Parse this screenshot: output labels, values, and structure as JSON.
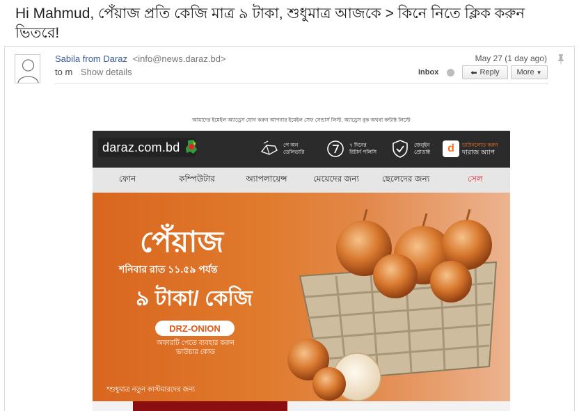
{
  "subject": "Hi Mahmud, পেঁয়াজ প্রতি কেজি মাত্র ৯ টাকা, শুধুমাত্র আজকে > কিনে নিতে ক্লিক করুন ভিতরে!",
  "header": {
    "sender_name": "Sabila from Daraz",
    "sender_email": "<info@news.daraz.bd>",
    "to_prefix": "to m",
    "show_details": "Show details",
    "date": "May 27 (1 day ago)",
    "inbox": "Inbox",
    "reply_label": "Reply",
    "more_label": "More"
  },
  "email": {
    "preheader": "আমাদের ইমেইল অ্যাড্রেস যোগ করুন আপনার ইমেইল সেফ সেন্ডার্স লিস্ট, অ্যাড্রেস বুক অথবা কন্টাক্ট লিস্টে",
    "logo_text": "daraz.com.bd",
    "features": [
      {
        "icon": "delivery-icon",
        "line1": "পে অন",
        "line2": "ডেলিভারি"
      },
      {
        "icon": "return-7-icon",
        "line1": "৭ দিনের",
        "line2": "রিটার্ন পলিসি"
      },
      {
        "icon": "genuine-shield-icon",
        "line1": "জেনুইন",
        "line2": "প্রোডাক্ট"
      }
    ],
    "app": {
      "icon_letter": "d",
      "small": "ডাউনলোড করুন",
      "big": "দারাজ অ্যাপ"
    },
    "categories": [
      "ফোন",
      "কম্পিউটার",
      "অ্যাপলায়েন্স",
      "মেয়েদের জন্য",
      "ছেলেদের জন্য",
      "সেল"
    ],
    "banner": {
      "title": "পেঁয়াজ",
      "subtitle": "শনিবার রাত ১১.৫৯ পর্যন্ত",
      "price": "৯ টাকা/ কেজি",
      "code": "DRZ-ONION",
      "note_line1": "অফারটি পেতে ব্যবহার করুন",
      "note_line2": "ভাউচার কোড",
      "footnote": "*শুধুমাত্র নতুন কাস্টমারদের জন্য"
    }
  },
  "colors": {
    "accent": "#f57224",
    "banner_orange": "#e07a2c",
    "sale_red": "#e4232a",
    "link_blue": "#3b5998"
  }
}
